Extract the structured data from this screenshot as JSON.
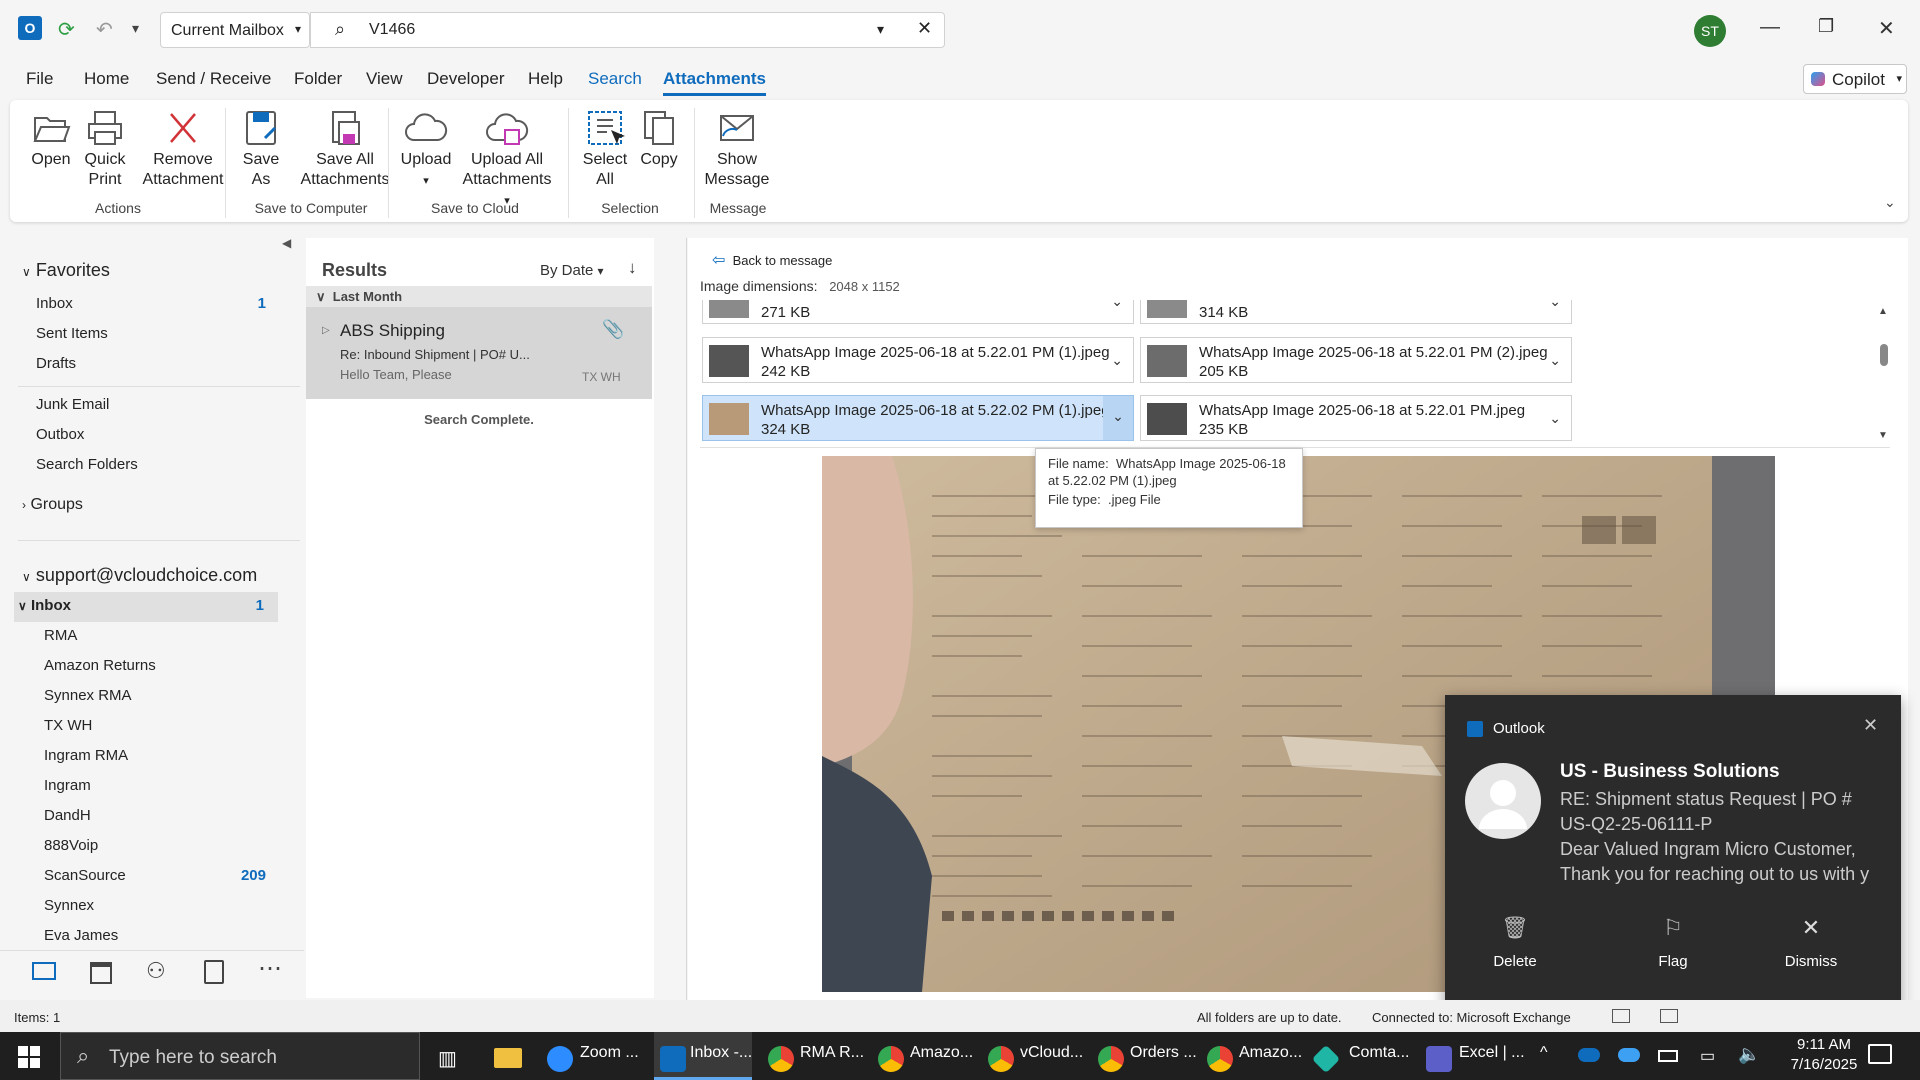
{
  "titlebar": {
    "mailbox_scope": "Current Mailbox",
    "search_query": "V1466",
    "user_initials": "ST"
  },
  "menu": [
    "File",
    "Home",
    "Send / Receive",
    "Folder",
    "View",
    "Developer",
    "Help",
    "Search",
    "Attachments"
  ],
  "copilot_label": "Copilot",
  "ribbon": {
    "actions": {
      "group": "Actions",
      "open": "Open",
      "quick_print": [
        "Quick",
        "Print"
      ],
      "remove": [
        "Remove",
        "Attachment"
      ]
    },
    "computer": {
      "group": "Save to Computer",
      "save_as": [
        "Save",
        "As"
      ],
      "save_all": [
        "Save All",
        "Attachments"
      ]
    },
    "cloud": {
      "group": "Save to Cloud",
      "upload": "Upload",
      "upload_all": [
        "Upload All",
        "Attachments"
      ]
    },
    "selection": {
      "group": "Selection",
      "select_all": [
        "Select",
        "All"
      ],
      "copy": "Copy"
    },
    "message": {
      "group": "Message",
      "show": [
        "Show",
        "Message"
      ]
    }
  },
  "nav": {
    "favorites": "Favorites",
    "fav_items": [
      {
        "label": "Inbox",
        "count": "1"
      },
      {
        "label": "Sent Items",
        "count": ""
      },
      {
        "label": "Drafts",
        "count": ""
      },
      {
        "label": "Junk Email",
        "count": ""
      },
      {
        "label": "Outbox",
        "count": ""
      },
      {
        "label": "Search Folders",
        "count": ""
      }
    ],
    "groups": "Groups",
    "account": "support@vcloudchoice.com",
    "inbox": {
      "label": "Inbox",
      "count": "1"
    },
    "folders": [
      {
        "label": "RMA",
        "count": ""
      },
      {
        "label": "Amazon Returns",
        "count": ""
      },
      {
        "label": "Synnex RMA",
        "count": ""
      },
      {
        "label": "TX WH",
        "count": ""
      },
      {
        "label": "Ingram RMA",
        "count": ""
      },
      {
        "label": "Ingram",
        "count": ""
      },
      {
        "label": "DandH",
        "count": ""
      },
      {
        "label": "888Voip",
        "count": ""
      },
      {
        "label": "ScanSource",
        "count": "209"
      },
      {
        "label": "Synnex",
        "count": ""
      },
      {
        "label": "Eva James",
        "count": ""
      }
    ]
  },
  "results": {
    "title": "Results",
    "sort": "By Date",
    "group": "Last Month",
    "item": {
      "sender": "ABS Shipping",
      "subject": "Re: Inbound Shipment | PO# U...",
      "preview": "Hello Team,  Please",
      "folder": "TX WH"
    },
    "status": "Search Complete."
  },
  "reading": {
    "back": "Back to message",
    "dim_label": "Image dimensions:",
    "dim_value": "2048 x 1152",
    "attachments": [
      {
        "name": "",
        "size": "271 KB"
      },
      {
        "name": "",
        "size": "314 KB"
      },
      {
        "name": "WhatsApp Image 2025-06-18 at 5.22.01 PM (1).jpeg",
        "size": "242 KB"
      },
      {
        "name": "WhatsApp Image 2025-06-18 at 5.22.01 PM (2).jpeg",
        "size": "205 KB"
      },
      {
        "name": "WhatsApp Image 2025-06-18 at 5.22.02 PM (1).jpeg",
        "size": "324 KB"
      },
      {
        "name": "WhatsApp Image 2025-06-18 at 5.22.01 PM.jpeg",
        "size": "235 KB"
      }
    ],
    "tooltip": {
      "name_label": "File name:",
      "name_value": "WhatsApp Image 2025-06-18 at 5.22.02 PM (1).jpeg",
      "type_label": "File type:",
      "type_value": ".jpeg File"
    }
  },
  "toast": {
    "app": "Outlook",
    "sender": "US - Business Solutions",
    "subject": "RE: Shipment status Request | PO # US-Q2-25-06111-P",
    "body": "Dear Valued Ingram Micro Customer, Thank you for reaching out to us with y",
    "delete": "Delete",
    "flag": "Flag",
    "dismiss": "Dismiss"
  },
  "status": {
    "items": "Items: 1",
    "sync": "All folders are up to date.",
    "connection": "Connected to: Microsoft Exchange"
  },
  "taskbar": {
    "search_placeholder": "Type here to search",
    "apps": [
      "Zoom ...",
      "Inbox -...",
      "RMA R...",
      "Amazo...",
      "vCloud...",
      "Orders ...",
      "Amazo...",
      "Comta...",
      "Excel | ..."
    ],
    "time": "9:11 AM",
    "date": "7/16/2025"
  },
  "colors": {
    "accent": "#0f6cbd",
    "ribbon_red": "#d13438",
    "toast_bg": "#2b2b2b",
    "taskbar": "#1f1f1f"
  }
}
